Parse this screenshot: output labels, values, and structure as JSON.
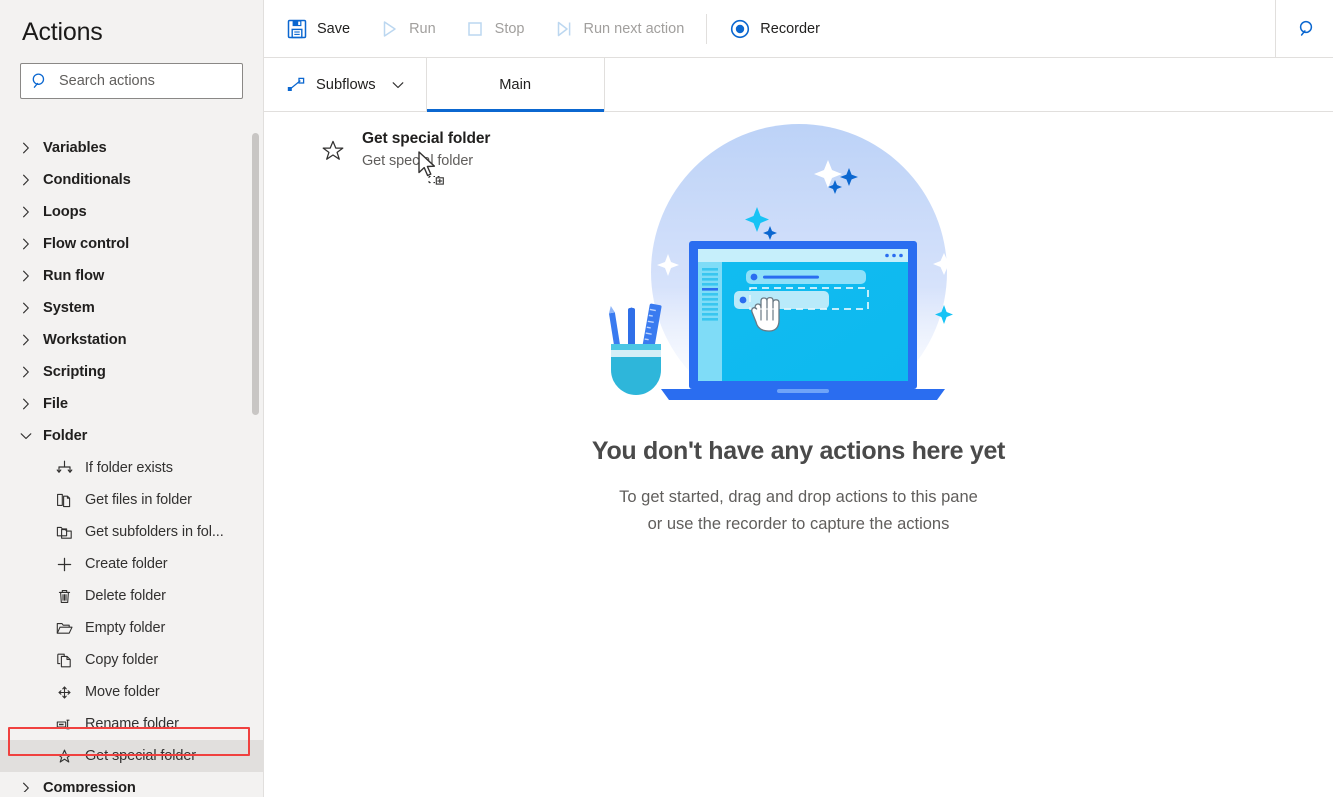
{
  "sidebar": {
    "title": "Actions",
    "search": {
      "placeholder": "Search actions",
      "value": "",
      "icon": "search-icon"
    },
    "groups": [
      {
        "label": "Variables",
        "icon": "chevron-right-icon",
        "expanded": false
      },
      {
        "label": "Conditionals",
        "icon": "chevron-right-icon",
        "expanded": false
      },
      {
        "label": "Loops",
        "icon": "chevron-right-icon",
        "expanded": false
      },
      {
        "label": "Flow control",
        "icon": "chevron-right-icon",
        "expanded": false
      },
      {
        "label": "Run flow",
        "icon": "chevron-right-icon",
        "expanded": false
      },
      {
        "label": "System",
        "icon": "chevron-right-icon",
        "expanded": false
      },
      {
        "label": "Workstation",
        "icon": "chevron-right-icon",
        "expanded": false
      },
      {
        "label": "Scripting",
        "icon": "chevron-right-icon",
        "expanded": false
      },
      {
        "label": "File",
        "icon": "chevron-right-icon",
        "expanded": false
      },
      {
        "label": "Folder",
        "icon": "chevron-down-icon",
        "expanded": true
      }
    ],
    "folder_items": [
      {
        "label": "If folder exists",
        "icon": "split-arrows-icon"
      },
      {
        "label": "Get files in folder",
        "icon": "folder-files-icon"
      },
      {
        "label": "Get subfolders in fol...",
        "icon": "folders-icon"
      },
      {
        "label": "Create folder",
        "icon": "plus-icon"
      },
      {
        "label": "Delete folder",
        "icon": "trash-icon"
      },
      {
        "label": "Empty folder",
        "icon": "open-folder-icon"
      },
      {
        "label": "Copy folder",
        "icon": "copy-pages-icon"
      },
      {
        "label": "Move folder",
        "icon": "move-arrows-icon"
      },
      {
        "label": "Rename folder",
        "icon": "rename-icon"
      },
      {
        "label": "Get special folder",
        "icon": "star-icon",
        "selected": true,
        "highlighted": true
      }
    ],
    "trailing_groups": [
      {
        "label": "Compression",
        "icon": "chevron-right-icon",
        "expanded": false
      }
    ],
    "highlight_color": "#f0413f",
    "selected_bg": "#e1dfdd"
  },
  "toolbar": {
    "items": [
      {
        "label": "Save",
        "icon": "save-icon",
        "enabled": true
      },
      {
        "label": "Run",
        "icon": "play-icon",
        "enabled": false
      },
      {
        "label": "Stop",
        "icon": "stop-square-icon",
        "enabled": false
      },
      {
        "label": "Run next action",
        "icon": "step-forward-icon",
        "enabled": false
      }
    ],
    "recorder": {
      "label": "Recorder",
      "icon": "record-icon"
    },
    "search_icon": "search-icon",
    "accent_color": "#0b67d0"
  },
  "tabs": {
    "subflows": {
      "label": "Subflows",
      "icon": "subflow-icon",
      "chevron": "chevron-down-icon"
    },
    "items": [
      {
        "label": "Main",
        "active": true
      }
    ]
  },
  "canvas": {
    "drag_ghost": {
      "title": "Get special folder",
      "subtitle": "Get special folder",
      "icon": "star-icon",
      "cursor": "drag-copy-cursor"
    },
    "empty_state": {
      "title": "You don't have any actions here yet",
      "line1": "To get started, drag and drop actions to this pane",
      "line2": "or use the recorder to capture the actions",
      "illustration": "laptop-drag-drop-illustration"
    }
  }
}
